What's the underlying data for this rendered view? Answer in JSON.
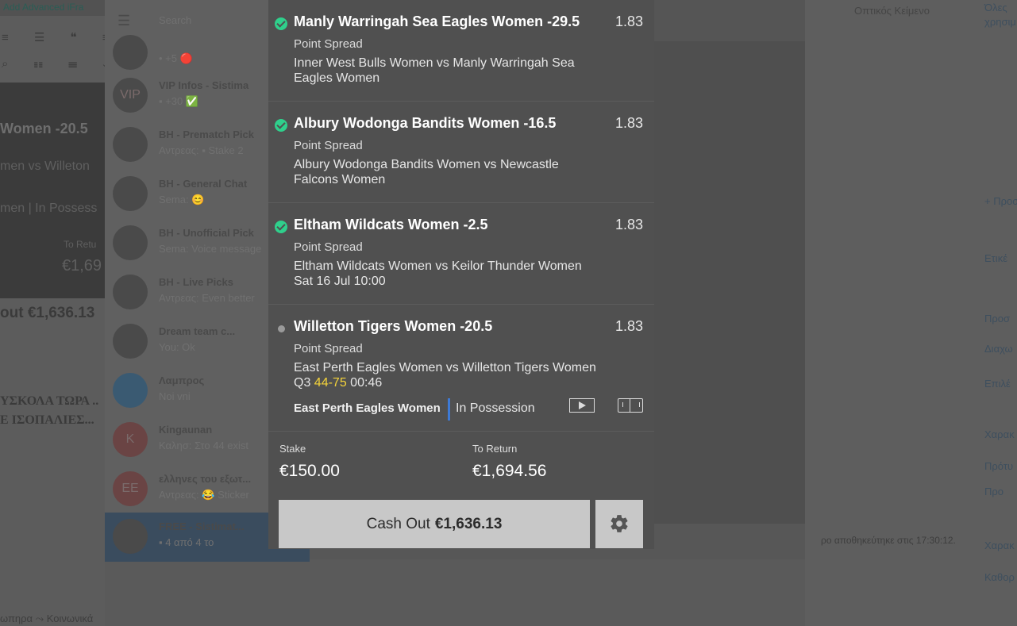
{
  "background": {
    "editor_top_text": "Add Advanced iFra",
    "editor_toolbar_1": "≡ ☰ ❝ ≡ ☰",
    "editor_toolbar_2": "⌕ ☷ ☰ ↶ ↷",
    "card_title": "Women -20.5",
    "card_line2": "men vs Willeton",
    "card_line3": "men | In Possess",
    "card_to_return_label": "To Retu",
    "card_to_return_value": "€1,69",
    "cashout_text": "out €1,636.13",
    "greek_line1": "ΥΣΚΟΛΑ ΤΩΡΑ ..",
    "greek_line2": "Ε ΙΣΟΠΑΛΙΕΣ...",
    "bottom_text": "ωπηρα   ⤳ Κοινωνικά",
    "search_placeholder": "Search",
    "chats": [
      {
        "name": "",
        "message": "• +5 🔴",
        "avatar": ""
      },
      {
        "name": "VIP Infos - Sistima",
        "message": "▪ +30 ✅",
        "avatar": "VIP"
      },
      {
        "name": "BH - Prematch Pick",
        "message": "Αντρεας: ▪ Stake 2",
        "avatar": ""
      },
      {
        "name": "BH - General Chat",
        "message": "Sema: 😊",
        "avatar": ""
      },
      {
        "name": "BH - Unofficial Pick",
        "message": "Sema: Voice message",
        "avatar": ""
      },
      {
        "name": "BH - Live Picks",
        "message": "Αντρεας: Even better",
        "avatar": ""
      },
      {
        "name": "Dream team c...",
        "message": "You: Ok",
        "avatar": ""
      },
      {
        "name": "Λαμπρος",
        "message": "Noi vni",
        "avatar": ""
      },
      {
        "name": "Kingaunan",
        "message": "Καλησ: Στο 44 exist",
        "avatar": "K"
      },
      {
        "name": "ελληνες του εξωτ...",
        "message": "Αντρεας: 😂 Sticker",
        "avatar": "EE"
      },
      {
        "name": "FREE - Sistimat...",
        "message": "▪ 4 από 4 το",
        "avatar": ""
      }
    ],
    "chat_footer_saved": "ρο αποθηκεύτηκε στις 17:30:12.",
    "right_top": "Οπτικός   Κείμενο",
    "right_side": [
      "Όλες",
      "χρησιμ",
      "+ Προσ",
      "Ετικέ",
      "Προσ",
      "Διαχω",
      "Επιλέ",
      "Χαρακ",
      "Πρότυ",
      "Προ",
      "Χαρακ",
      "Καθορ"
    ]
  },
  "slip": {
    "selections": [
      {
        "status": "won",
        "title": "Manly Warringah Sea Eagles Women -29.5",
        "odds": "1.83",
        "market": "Point Spread",
        "event_line1": "Inner West Bulls Women vs Manly Warringah Sea",
        "event_line2": "Eagles Women"
      },
      {
        "status": "won",
        "title": "Albury Wodonga Bandits Women -16.5",
        "odds": "1.83",
        "market": "Point Spread",
        "event_line1": "Albury Wodonga Bandits Women vs Newcastle",
        "event_line2": "Falcons Women"
      },
      {
        "status": "won",
        "title": "Eltham Wildcats Women -2.5",
        "odds": "1.83",
        "market": "Point Spread",
        "event_line1": "Eltham Wildcats Women vs Keilor Thunder Women",
        "event_line2": "Sat 16 Jul 10:00"
      },
      {
        "status": "open",
        "title": "Willetton Tigers Women -20.5",
        "odds": "1.83",
        "market": "Point Spread",
        "event_line1": "East Perth Eagles Women vs Willetton Tigers Women",
        "period": "Q3",
        "score": "44-75",
        "clock": "00:46",
        "possession_team": "East Perth Eagles Women",
        "possession_label": "In Possession"
      }
    ],
    "stake_label": "Stake",
    "stake_value": "€150.00",
    "return_label": "To Return",
    "return_value": "€1,694.56",
    "cashout_label": "Cash Out",
    "cashout_value": "€1,636.13"
  },
  "colors": {
    "won_check": "#2fd08c",
    "score_highlight": "#f4d33a",
    "possession_bar": "#3d7ad6",
    "slip_background": "#505050",
    "button_background": "#c8c8c8"
  },
  "icons": [
    "check-circle-icon",
    "pending-dot-icon",
    "play-video-icon",
    "court-icon",
    "gear-icon"
  ]
}
